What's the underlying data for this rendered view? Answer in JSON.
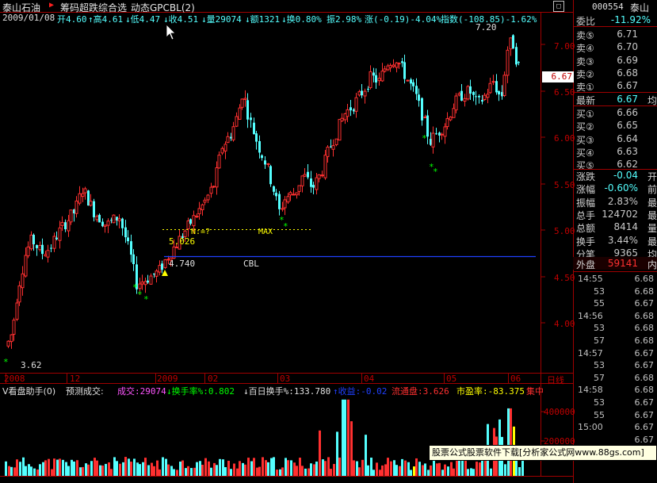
{
  "header": {
    "stock_name": "泰山石油",
    "indicator_name": "筹码超跌综合选",
    "indicator_sub": "动态GPCBL(2)",
    "corner_icon": "restore-window-icon"
  },
  "info_bar": {
    "date": "2009/01/08",
    "open": "开4.60",
    "high": "↑高4.61",
    "low": "↓低4.47",
    "close": "↓收4.51",
    "volume": "↓量29074",
    "amount": "↓额1321",
    "turnover": "↓换0.80%",
    "amplitude": "振2.98%",
    "change": "涨(-0.19)-4.04%",
    "index": "指数(-108.85)-1.62%"
  },
  "price_axis": {
    "ticks": [
      "7.00",
      "6.50",
      "6.00",
      "5.50",
      "5.00",
      "4.50",
      "4.00"
    ],
    "current_tag": "6.67"
  },
  "date_axis": {
    "labels": [
      "2008",
      "12",
      "2009",
      "02",
      "03",
      "04",
      "05",
      "06"
    ],
    "period": "日线"
  },
  "annotations": {
    "max_price": "7.20",
    "min_price": "3.62",
    "level_5": "5.026",
    "n_label": "N:=?",
    "max_label": "MAX",
    "cbl_value": "4.740",
    "cbl_label": "CBL"
  },
  "volume_bar": {
    "name": "V看盘助手(0)",
    "forecast": "预测成交:",
    "deal": "成交:29074",
    "turnover_rate": "↓换手率%:0.802",
    "hundred_day": "↓百日换手%:133.780",
    "profit": "↑收益:-0.02",
    "float_cap": "流通盘:3.626",
    "pe": "市盈率:-83.375",
    "extra": "集中",
    "ticks": [
      "400000",
      "200000"
    ]
  },
  "quote_panel": {
    "code": "000554",
    "name": "泰山",
    "ratio_label": "委比",
    "ratio_value": "-11.92%",
    "ratio_ext": "委",
    "sells": [
      {
        "label": "卖⑤",
        "price": "6.71",
        "ext": ""
      },
      {
        "label": "卖④",
        "price": "6.70",
        "ext": ""
      },
      {
        "label": "卖③",
        "price": "6.69",
        "ext": ""
      },
      {
        "label": "卖②",
        "price": "6.68",
        "ext": ""
      },
      {
        "label": "卖①",
        "price": "6.67",
        "ext": ""
      }
    ],
    "latest_label": "最新",
    "latest_value": "6.67",
    "latest_ext": "均",
    "buys": [
      {
        "label": "买①",
        "price": "6.66",
        "ext": ""
      },
      {
        "label": "买②",
        "price": "6.65",
        "ext": ""
      },
      {
        "label": "买③",
        "price": "6.64",
        "ext": ""
      },
      {
        "label": "买④",
        "price": "6.63",
        "ext": ""
      },
      {
        "label": "买⑤",
        "price": "6.62",
        "ext": ""
      }
    ],
    "stats": [
      {
        "label": "涨跌",
        "value": "-0.04",
        "ext": "开"
      },
      {
        "label": "涨幅",
        "value": "-0.60%",
        "ext": "前"
      },
      {
        "label": "振幅",
        "value": "2.83%",
        "ext": "最"
      },
      {
        "label": "总手",
        "value": "124702",
        "ext": "最"
      },
      {
        "label": "总额",
        "value": "8414",
        "ext": "量"
      },
      {
        "label": "换手",
        "value": "3.44%",
        "ext": "最"
      },
      {
        "label": "分笔",
        "value": "9365",
        "ext": "均"
      }
    ],
    "outer_label": "外盘",
    "outer_value": "59141",
    "outer_ext": "内",
    "ticks": [
      {
        "time": "14:55",
        "price": "6.68"
      },
      {
        "time": "53",
        "price": "6.68"
      },
      {
        "time": "55",
        "price": "6.67"
      },
      {
        "time": "14:56",
        "price": "6.68"
      },
      {
        "time": "53",
        "price": "6.68"
      },
      {
        "time": "57",
        "price": "6.68"
      },
      {
        "time": "14:57",
        "price": "6.67"
      },
      {
        "time": "53",
        "price": "6.67"
      },
      {
        "time": "57",
        "price": "6.68"
      },
      {
        "time": "14:58",
        "price": "6.68"
      },
      {
        "time": "53",
        "price": "6.67"
      },
      {
        "time": "55",
        "price": "6.67"
      },
      {
        "time": "15:00",
        "price": "6.67"
      },
      {
        "time": "",
        "price": "6.67"
      }
    ]
  },
  "watermark": "股票公式股票软件下载[分析家公式网www.88gs.com]",
  "colors": {
    "up": "#ff3030",
    "down": "#54ffff",
    "axis": "#a00000",
    "yellow": "#ffff00",
    "green": "#00ff00",
    "magenta": "#ff55ff",
    "blue": "#2040ff"
  }
}
